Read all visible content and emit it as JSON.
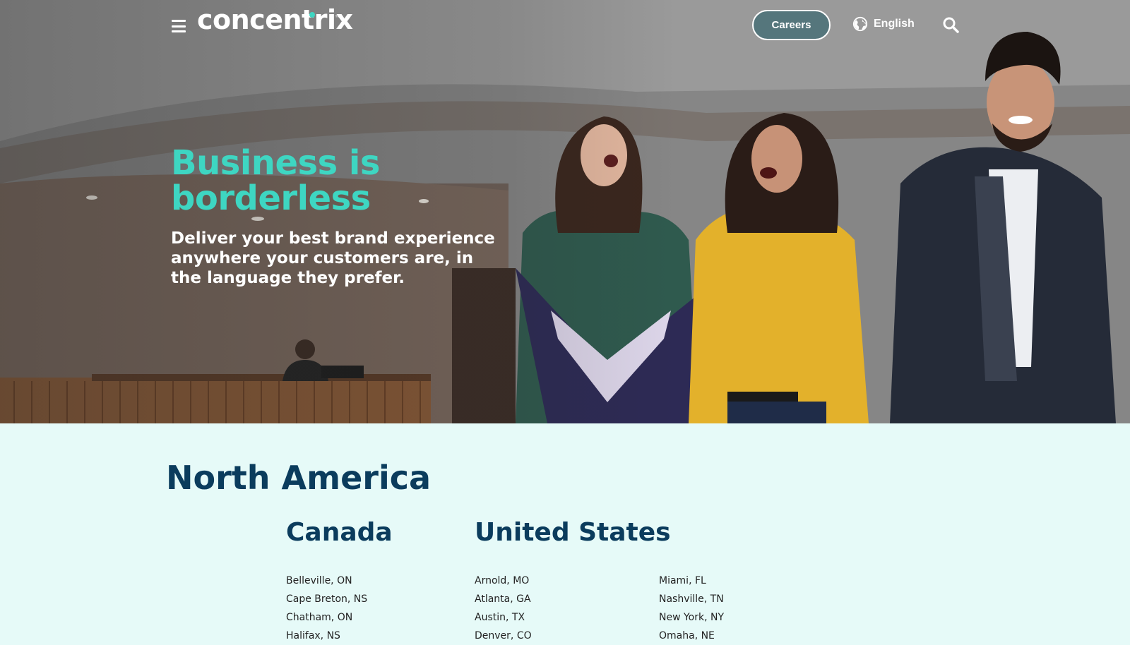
{
  "header": {
    "logo_text": "concentrix",
    "careers_label": "Careers",
    "language_label": "English"
  },
  "hero": {
    "title": "Business is borderless",
    "subtitle": "Deliver your best brand experience anywhere your customers are, in the language they prefer."
  },
  "locations": {
    "region": "North America",
    "countries": [
      {
        "name": "Canada",
        "cities": [
          "Belleville, ON",
          "Cape Breton, NS",
          "Chatham, ON",
          "Halifax, NS"
        ]
      },
      {
        "name": "United States",
        "cities_col1": [
          "Arnold, MO",
          "Atlanta, GA",
          "Austin, TX",
          "Denver, CO"
        ],
        "cities_col2": [
          "Miami, FL",
          "Nashville, TN",
          "New York, NY",
          "Omaha, NE"
        ]
      }
    ]
  },
  "colors": {
    "accent_teal": "#3ed6c2",
    "heading_navy": "#0b3c5d",
    "page_background": "#e6faf8"
  }
}
